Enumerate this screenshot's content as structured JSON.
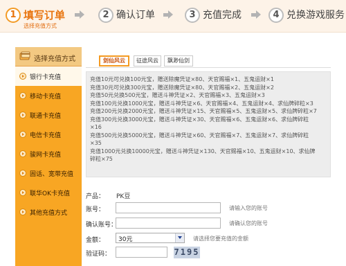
{
  "steps": [
    {
      "number": "1",
      "label": "填写订单",
      "sublabel": "选择充值方式"
    },
    {
      "number": "2",
      "label": "确认订单"
    },
    {
      "number": "3",
      "label": "充值完成"
    },
    {
      "number": "4",
      "label": "兑换游戏服务"
    }
  ],
  "sidebar": {
    "title": "选择充值方式",
    "items": [
      {
        "label": "银行卡充值"
      },
      {
        "label": "移动卡充值"
      },
      {
        "label": "联通卡充值"
      },
      {
        "label": "电信卡充值"
      },
      {
        "label": "骏网卡充值"
      },
      {
        "label": "固话、宽带充值"
      },
      {
        "label": "联华OK卡充值"
      },
      {
        "label": "其他充值方式"
      }
    ]
  },
  "tabs": [
    {
      "label": "剑仙风云"
    },
    {
      "label": "征途风云"
    },
    {
      "label": "飘渺仙剑"
    }
  ],
  "info_lines": [
    "充值10元可兑换100元宝，赠送除魔凭证×80、天官赐福×1、五鬼运财×1",
    "充值30元可兑换300元宝，赠送除魔凭证×80、天官赐福×2、五鬼运财×2",
    "充值50元兑换500元宝，赠送斗神凭证×2、天官赐福×3、五鬼运财×3",
    "充值100元兑换1000元宝，赠送斗神凭证×6、天官赐福×4、五鬼运财×4、求仙牌碎粒×3",
    "充值200元兑换2000元宝，赠送斗神凭证×15、天官赐福×5、五鬼运财×5、求仙牌碎粒×7",
    "充值300元兑换3000元宝，赠送斗神凭证×30、天官赐福×6、五鬼运财×6、求仙牌碎粒",
    "×16",
    "充值500元兑换5000元宝，赠送斗神凭证×60、天官赐福×7、五鬼运财×7、求仙牌碎粒",
    "×35",
    "充值1000元兑换10000元宝，赠送斗神凭证×130、天官赐福×10、五鬼运财×10、求仙牌",
    "碎粒×75"
  ],
  "form": {
    "product_label": "产品：",
    "product_value": "PK豆",
    "account_label": "账号：",
    "account_value": "",
    "account_hint": "请输入您的账号",
    "confirm_label": "确认账号：",
    "confirm_value": "",
    "confirm_hint": "请确认您的账号",
    "amount_label": "金额：",
    "amount_value": "30元",
    "amount_hint": "请选择您要充值的金额",
    "captcha_label": "验证码：",
    "captcha_value": "",
    "captcha_text": "7195"
  },
  "colors": {
    "accent_orange": "#f39b26",
    "sidebar_bg": "#f8a623",
    "step_bar_bg": "#fdf3e8"
  }
}
